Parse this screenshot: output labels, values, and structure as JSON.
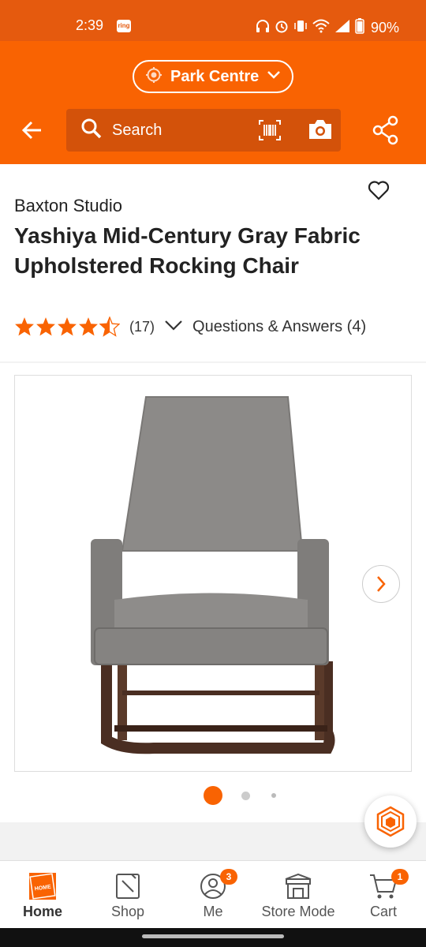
{
  "status_bar": {
    "time": "2:39",
    "ring_badge": "ring",
    "battery": "90%"
  },
  "header": {
    "store_name": "Park Centre",
    "search_placeholder": "Search"
  },
  "product": {
    "brand": "Baxton Studio",
    "title": "Yashiya Mid-Century Gray Fabric Upholstered Rocking Chair",
    "rating": 4.5,
    "review_count": "(17)",
    "qa_label": "Questions & Answers (4)"
  },
  "gallery": {
    "image_count": 3,
    "active_index": 0
  },
  "colors": {
    "brand_orange": "#f96302",
    "status_orange": "#e55a0e"
  },
  "bottom_nav": {
    "home": "Home",
    "shop": "Shop",
    "me": "Me",
    "me_badge": "3",
    "store_mode": "Store Mode",
    "cart": "Cart",
    "cart_badge": "1"
  }
}
